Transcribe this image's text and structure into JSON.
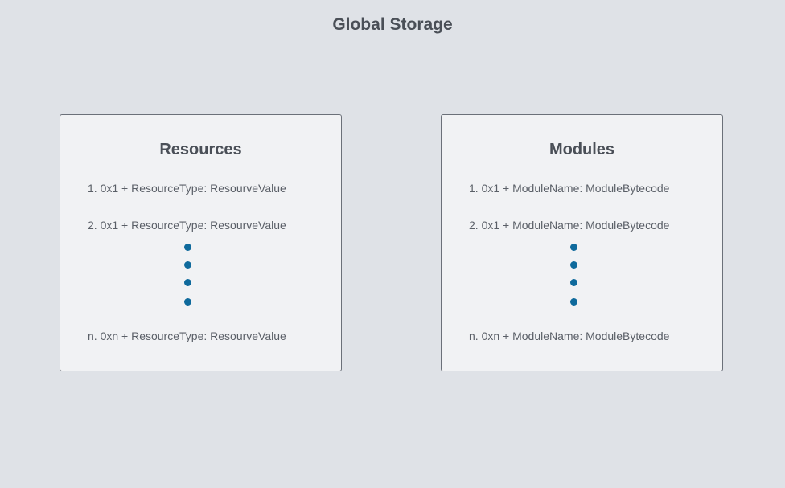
{
  "title": "Global Storage",
  "resources": {
    "title": "Resources",
    "entries": [
      "1. 0x1 + ResourceType: ResourveValue",
      "2. 0x1 + ResourceType: ResourveValue",
      "n. 0xn + ResourceType: ResourveValue"
    ]
  },
  "modules": {
    "title": "Modules",
    "entries": [
      "1. 0x1 + ModuleName: ModuleBytecode",
      "2. 0x1 + ModuleName: ModuleBytecode",
      "n. 0xn + ModuleName: ModuleBytecode"
    ]
  },
  "colors": {
    "background": "#dfe2e7",
    "box_fill": "#f1f2f4",
    "box_border": "#6b7079",
    "dot": "#0f6a9c",
    "text": "#4a4f57"
  }
}
